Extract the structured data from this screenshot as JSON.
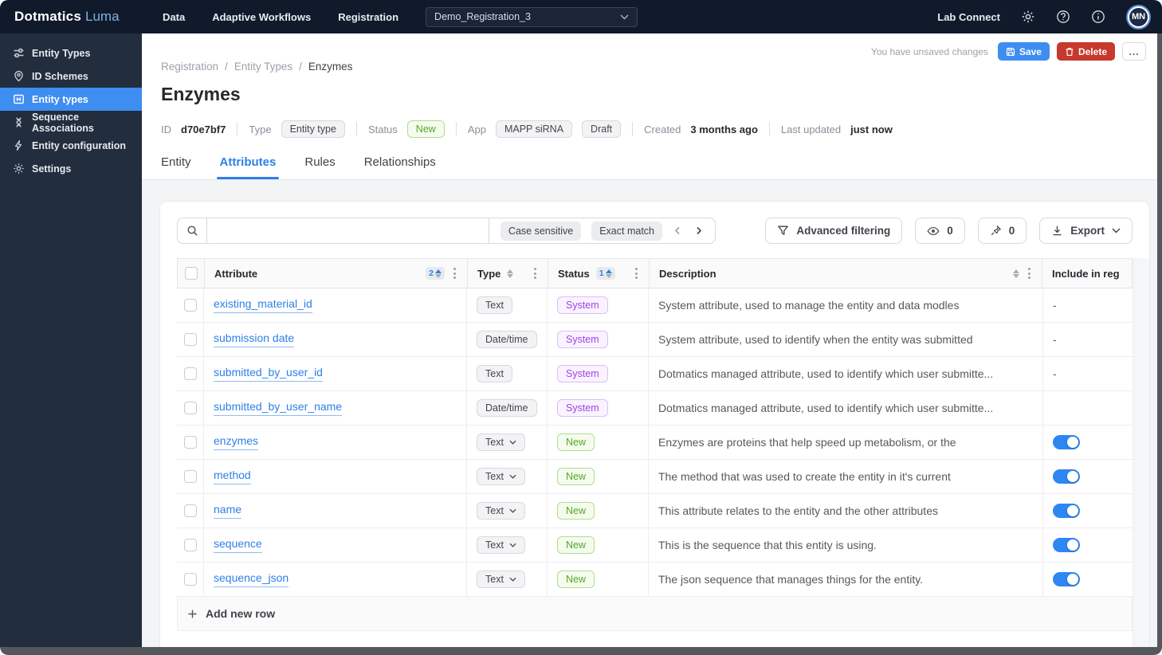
{
  "navbar": {
    "logo": {
      "brand": "Dotmatics",
      "product": "Luma"
    },
    "items": [
      {
        "label": "Data"
      },
      {
        "label": "Adaptive Workflows"
      },
      {
        "label": "Registration"
      }
    ],
    "project_selector": {
      "value": "Demo_Registration_3"
    },
    "right": {
      "lab_connect": "Lab Connect",
      "avatar_initials": "MN"
    }
  },
  "sidebar": {
    "items": [
      {
        "label": "Entity Types"
      },
      {
        "label": "ID Schemes"
      },
      {
        "label": "Entity types"
      },
      {
        "label": "Sequence Associations"
      },
      {
        "label": "Entity configuration"
      },
      {
        "label": "Settings"
      }
    ]
  },
  "header": {
    "breadcrumb": [
      "Registration",
      "Entity Types",
      "Enzymes"
    ],
    "breadcrumb_separator": "/",
    "title": "Enzymes",
    "unsaved_note": "You have unsaved changes",
    "actions": {
      "save": "Save",
      "delete": "Delete",
      "more": "..."
    }
  },
  "meta": {
    "id_label": "ID",
    "id_value": "d70e7bf7",
    "type_label": "Type",
    "type_badge": "Entity type",
    "status_label": "Status",
    "status_badge": "New",
    "app_label": "App",
    "app_badges": [
      "MAPP siRNA",
      "Draft"
    ],
    "created_label": "Created",
    "created_value": "3 months ago",
    "updated_label": "Last updated",
    "updated_value": "just now"
  },
  "tabs": [
    {
      "label": "Entity"
    },
    {
      "label": "Attributes",
      "active": true
    },
    {
      "label": "Rules"
    },
    {
      "label": "Relationships"
    }
  ],
  "toolbar": {
    "case_sensitive": "Case sensitive",
    "exact_match": "Exact match",
    "advanced_filtering": "Advanced filtering",
    "eye_count": "0",
    "pin_count": "0",
    "export": "Export"
  },
  "table": {
    "columns": {
      "attribute": "Attribute",
      "type": "Type",
      "status": "Status",
      "description": "Description",
      "include": "Include in reg"
    },
    "attribute_sort_order": "2",
    "status_sort_order": "1",
    "rows": [
      {
        "attribute": "existing_material_id",
        "type": "Text",
        "type_editable": false,
        "status": "System",
        "description": "System attribute, used to manage the entity and data modles",
        "include": "-"
      },
      {
        "attribute": "submission date",
        "type": "Date/time",
        "type_editable": false,
        "status": "System",
        "description": "System attribute, used to identify when the entity was submitted",
        "include": "-"
      },
      {
        "attribute": "submitted_by_user_id",
        "type": "Text",
        "type_editable": false,
        "status": "System",
        "description": "Dotmatics managed attribute, used to identify which user submitte...",
        "include": "-"
      },
      {
        "attribute": "submitted_by_user_name",
        "type": "Date/time",
        "type_editable": false,
        "status": "System",
        "description": "Dotmatics managed attribute, used to identify which user submitte...",
        "include": ""
      },
      {
        "attribute": "enzymes",
        "type": "Text",
        "type_editable": true,
        "status": "New",
        "description": "Enzymes are proteins that help speed up metabolism, or the",
        "include": "toggle-on"
      },
      {
        "attribute": "method",
        "type": "Text",
        "type_editable": true,
        "status": "New",
        "description": "The method that was used to create the entity in it's current",
        "include": "toggle-on"
      },
      {
        "attribute": "name",
        "type": "Text",
        "type_editable": true,
        "status": "New",
        "description": "This attribute relates to the entity and the other attributes",
        "include": "toggle-on"
      },
      {
        "attribute": "sequence",
        "type": "Text",
        "type_editable": true,
        "status": "New",
        "description": "This is the sequence that this entity is using.",
        "include": "toggle-on"
      },
      {
        "attribute": "sequence_json",
        "type": "Text",
        "type_editable": true,
        "status": "New",
        "description": "The json sequence that manages things for the entity.",
        "include": "toggle-on"
      }
    ],
    "add_row_label": "Add new row"
  },
  "colors": {
    "navbar_bg": "#101A2B",
    "sidebar_bg": "#222D3D",
    "accent_blue": "#2E7FE8",
    "active_item_blue": "#3E8DF0",
    "save_blue": "#3E8DF0",
    "delete_red": "#C7392C",
    "new_green": "#53A626",
    "system_purple": "#9B43E6",
    "toggle_blue": "#2E86F2",
    "page_bg": "#F3F4F6",
    "frame_grey": "#54585D"
  }
}
